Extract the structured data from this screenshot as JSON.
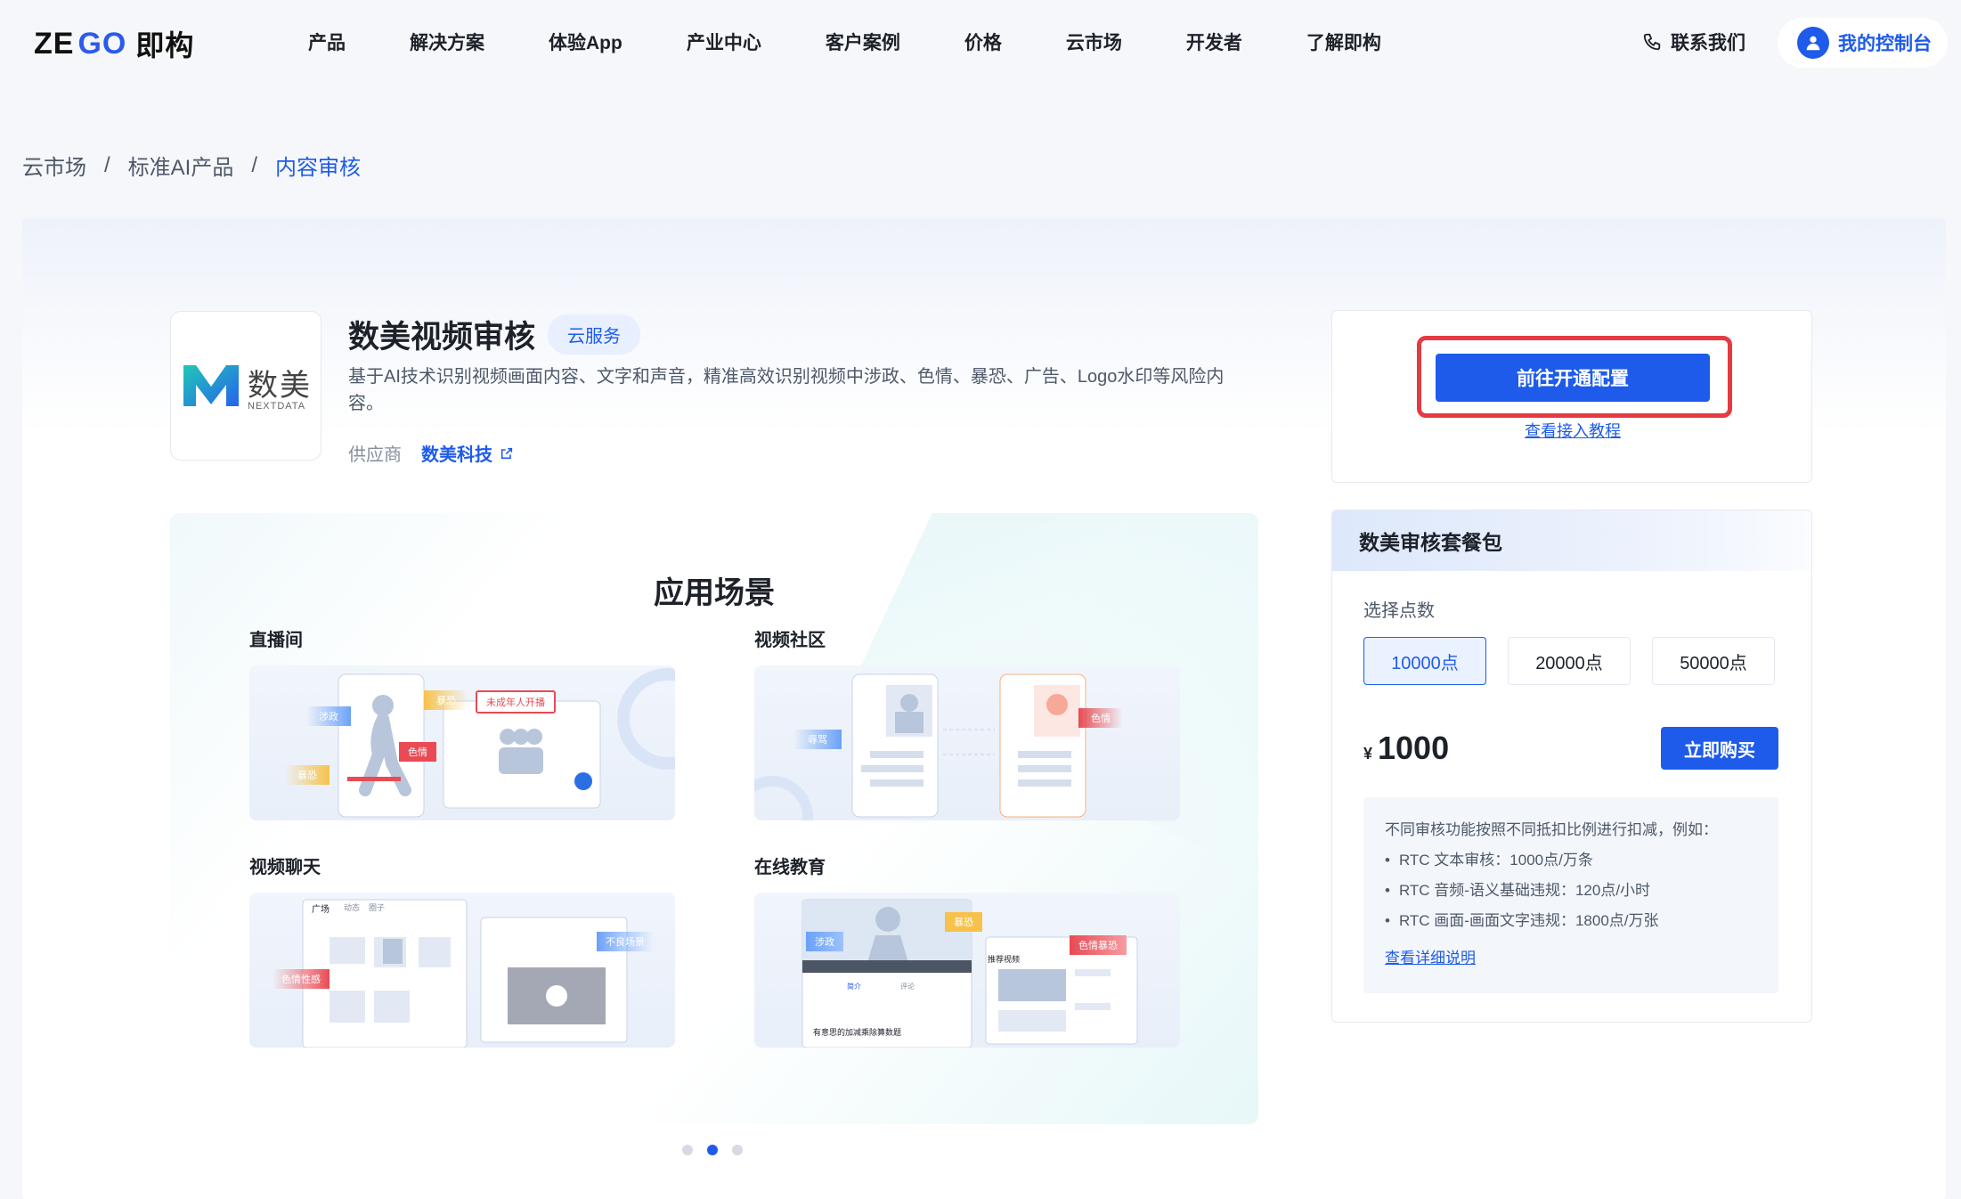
{
  "brand": {
    "logo_latin_1": "ZE",
    "logo_latin_2": "GO",
    "logo_cn": "即构"
  },
  "nav": {
    "items": [
      "产品",
      "解决方案",
      "体验App",
      "产业中心",
      "客户案例",
      "价格",
      "云市场",
      "开发者",
      "了解即构"
    ],
    "contact_label": "联系我们",
    "console_label": "我的控制台"
  },
  "breadcrumb": {
    "items": [
      "云市场",
      "标准AI产品",
      "内容审核"
    ],
    "separator": "/"
  },
  "product": {
    "logo_text": "数美",
    "logo_subtext": "NEXTDATA",
    "title": "数美视频审核",
    "tag": "云服务",
    "description": "基于AI技术识别视频画面内容、文字和声音，精准高效识别视频中涉政、色情、暴恐、广告、Logo水印等风险内容。",
    "supplier_label": "供应商",
    "supplier_name": "数美科技"
  },
  "scenarios": {
    "title": "应用场景",
    "items": [
      {
        "label": "直播间",
        "tags": [
          "涉政",
          "暴恐",
          "色情",
          "暴恐"
        ],
        "banner": "未成年人开播"
      },
      {
        "label": "视频社区",
        "tags": [
          "辱骂",
          "色情"
        ]
      },
      {
        "label": "视频聊天",
        "tags": [
          "色情性感",
          "不良场景"
        ],
        "tabs": [
          "广场",
          "动态",
          "圈子"
        ]
      },
      {
        "label": "在线教育",
        "tags": [
          "涉政",
          "暴恐",
          "色情暴恐"
        ],
        "panel_title": "推荐视频",
        "caption": "有意思的加减乘除算数题",
        "subtabs": [
          "简介",
          "评论"
        ]
      }
    ],
    "pager": {
      "count": 3,
      "active": 1
    }
  },
  "cta": {
    "button_label": "前往开通配置",
    "link_label": "查看接入教程"
  },
  "package": {
    "title": "数美审核套餐包",
    "select_label": "选择点数",
    "options": [
      "10000点",
      "20000点",
      "50000点"
    ],
    "selected_index": 0,
    "currency": "¥",
    "price": "1000",
    "buy_label": "立即购买",
    "notes_intro": "不同审核功能按照不同抵扣比例进行扣减，例如：",
    "notes": [
      "RTC 文本审核：1000点/万条",
      "RTC 音频-语义基础违规：120点/小时",
      "RTC 画面-画面文字违规：1800点/万张"
    ],
    "details_link": "查看详细说明"
  },
  "colors": {
    "accent": "#1e5bea",
    "highlight": "#e63a42"
  }
}
